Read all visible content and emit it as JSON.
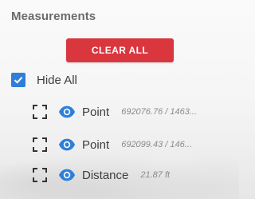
{
  "panel": {
    "title": "Measurements",
    "clear_all_label": "CLEAR ALL",
    "hide_all": {
      "label": "Hide All",
      "checked": true
    }
  },
  "measurements": [
    {
      "name": "Point",
      "value": "692076.76 / 1463...",
      "focus_icon": "focus-bracket-icon",
      "visibility_icon": "eye-icon"
    },
    {
      "name": "Point",
      "value": "692099.43 / 146...",
      "focus_icon": "focus-bracket-icon",
      "visibility_icon": "eye-icon"
    },
    {
      "name": "Distance",
      "value": "21.87 ft",
      "focus_icon": "focus-bracket-icon",
      "visibility_icon": "eye-icon"
    }
  ],
  "colors": {
    "accent_red": "#d9363e",
    "accent_blue": "#2f7fd8",
    "title_gray": "#6b6b6b",
    "text_dark": "#3d3d3d",
    "value_gray": "#8a8a8a"
  }
}
